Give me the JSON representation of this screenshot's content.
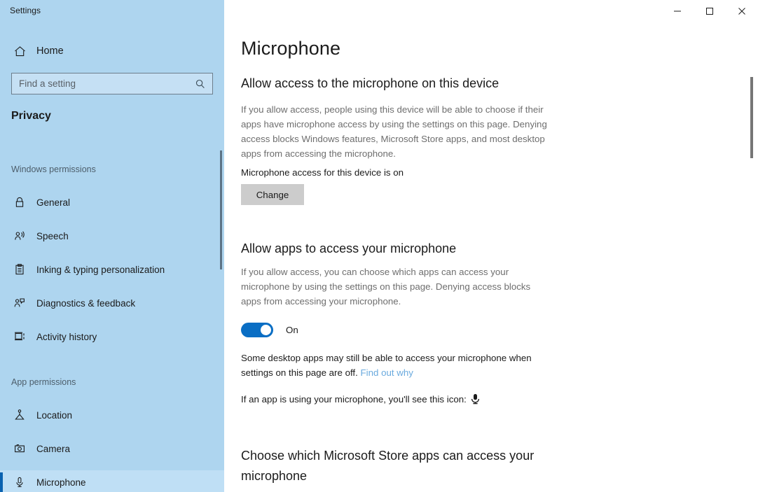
{
  "titlebar": {
    "app_title": "Settings",
    "minimize_label": "Minimize",
    "maximize_label": "Maximize",
    "close_label": "Close"
  },
  "sidebar": {
    "home_label": "Home",
    "home_icon": "home-icon",
    "search": {
      "placeholder": "Find a setting",
      "value": "",
      "icon": "search-icon"
    },
    "section_title": "Privacy",
    "groups": [
      {
        "label": "Windows permissions",
        "items": [
          {
            "label": "General",
            "icon": "lock-icon",
            "selected": false
          },
          {
            "label": "Speech",
            "icon": "speech-icon",
            "selected": false
          },
          {
            "label": "Inking & typing personalization",
            "icon": "clipboard-icon",
            "selected": false
          },
          {
            "label": "Diagnostics & feedback",
            "icon": "feedback-icon",
            "selected": false
          },
          {
            "label": "Activity history",
            "icon": "activity-icon",
            "selected": false
          }
        ]
      },
      {
        "label": "App permissions",
        "items": [
          {
            "label": "Location",
            "icon": "location-icon",
            "selected": false
          },
          {
            "label": "Camera",
            "icon": "camera-icon",
            "selected": false
          },
          {
            "label": "Microphone",
            "icon": "microphone-icon",
            "selected": true
          }
        ]
      }
    ]
  },
  "main": {
    "page_title": "Microphone",
    "device_section": {
      "heading": "Allow access to the microphone on this device",
      "description": "If you allow access, people using this device will be able to choose if their apps have microphone access by using the settings on this page. Denying access blocks Windows features, Microsoft Store apps, and most desktop apps from accessing the microphone.",
      "status": "Microphone access for this device is on",
      "change_button": "Change"
    },
    "apps_section": {
      "heading": "Allow apps to access your microphone",
      "description": "If you allow access, you can choose which apps can access your microphone by using the settings on this page. Denying access blocks apps from accessing your microphone.",
      "toggle_state": "On",
      "desktop_note_part1": "Some desktop apps may still be able to access your microphone when settings on this page are off.",
      "desktop_note_link": "Find out why",
      "icon_note": "If an app is using your microphone, you'll see this icon:",
      "icon_note_icon": "microphone-icon"
    },
    "store_section": {
      "heading": "Choose which Microsoft Store apps can access your microphone"
    }
  },
  "colors": {
    "sidebar_bg": "#aed5ef",
    "accent": "#0a6ec4",
    "selection_bar": "#0a62b0",
    "link": "#6aaade",
    "button_bg": "#cccccc"
  }
}
